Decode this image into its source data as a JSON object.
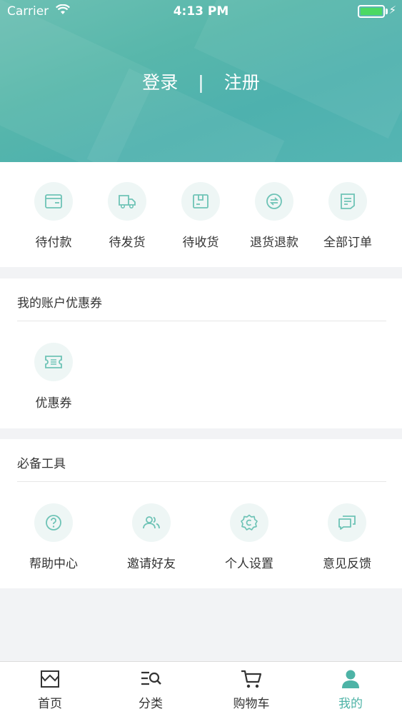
{
  "status_bar": {
    "carrier": "Carrier",
    "time": "4:13 PM"
  },
  "header": {
    "login": "登录",
    "separator": "|",
    "register": "注册"
  },
  "orders": {
    "items": [
      {
        "label": "待付款",
        "icon": "wallet-icon"
      },
      {
        "label": "待发货",
        "icon": "truck-icon"
      },
      {
        "label": "待收货",
        "icon": "package-icon"
      },
      {
        "label": "退货退款",
        "icon": "refund-icon"
      },
      {
        "label": "全部订单",
        "icon": "orders-list-icon"
      }
    ]
  },
  "account": {
    "title": "我的账户优惠券",
    "items": [
      {
        "label": "优惠券",
        "icon": "ticket-icon"
      }
    ]
  },
  "tools": {
    "title": "必备工具",
    "items": [
      {
        "label": "帮助中心",
        "icon": "help-icon"
      },
      {
        "label": "邀请好友",
        "icon": "friends-icon"
      },
      {
        "label": "个人设置",
        "icon": "settings-icon"
      },
      {
        "label": "意见反馈",
        "icon": "feedback-icon"
      }
    ]
  },
  "tabbar": {
    "items": [
      {
        "label": "首页",
        "icon": "home-store-icon"
      },
      {
        "label": "分类",
        "icon": "category-search-icon"
      },
      {
        "label": "购物车",
        "icon": "cart-icon"
      },
      {
        "label": "我的",
        "icon": "profile-icon"
      }
    ],
    "active_color": "#4db3a6"
  },
  "colors": {
    "accent": "#4db3a6",
    "icon_bg": "#eef6f5"
  }
}
